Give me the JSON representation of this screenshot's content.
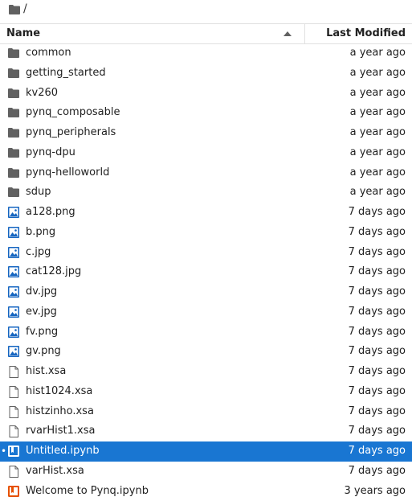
{
  "breadcrumb": {
    "separator": "/"
  },
  "header": {
    "name_label": "Name",
    "modified_label": "Last Modified"
  },
  "colors": {
    "selection": "#1976d2",
    "folder": "#616161",
    "image": "#1565c0",
    "notebook": "#1976d2",
    "pynq_notebook": "#e65100",
    "file": "#616161"
  },
  "files": [
    {
      "name": "common",
      "modified": "a year ago",
      "kind": "folder-icon"
    },
    {
      "name": "getting_started",
      "modified": "a year ago",
      "kind": "folder-icon"
    },
    {
      "name": "kv260",
      "modified": "a year ago",
      "kind": "folder-icon"
    },
    {
      "name": "pynq_composable",
      "modified": "a year ago",
      "kind": "folder-icon"
    },
    {
      "name": "pynq_peripherals",
      "modified": "a year ago",
      "kind": "folder-icon"
    },
    {
      "name": "pynq-dpu",
      "modified": "a year ago",
      "kind": "folder-icon"
    },
    {
      "name": "pynq-helloworld",
      "modified": "a year ago",
      "kind": "folder-icon"
    },
    {
      "name": "sdup",
      "modified": "a year ago",
      "kind": "folder-icon"
    },
    {
      "name": "a128.png",
      "modified": "7 days ago",
      "kind": "image-icon"
    },
    {
      "name": "b.png",
      "modified": "7 days ago",
      "kind": "image-icon"
    },
    {
      "name": "c.jpg",
      "modified": "7 days ago",
      "kind": "image-icon"
    },
    {
      "name": "cat128.jpg",
      "modified": "7 days ago",
      "kind": "image-icon"
    },
    {
      "name": "dv.jpg",
      "modified": "7 days ago",
      "kind": "image-icon"
    },
    {
      "name": "ev.jpg",
      "modified": "7 days ago",
      "kind": "image-icon"
    },
    {
      "name": "fv.png",
      "modified": "7 days ago",
      "kind": "image-icon"
    },
    {
      "name": "gv.png",
      "modified": "7 days ago",
      "kind": "image-icon"
    },
    {
      "name": "hist.xsa",
      "modified": "7 days ago",
      "kind": "file-icon"
    },
    {
      "name": "hist1024.xsa",
      "modified": "7 days ago",
      "kind": "file-icon"
    },
    {
      "name": "histzinho.xsa",
      "modified": "7 days ago",
      "kind": "file-icon"
    },
    {
      "name": "rvarHist1.xsa",
      "modified": "7 days ago",
      "kind": "file-icon"
    },
    {
      "name": "Untitled.ipynb",
      "modified": "7 days ago",
      "kind": "notebook-icon",
      "selected": true,
      "running": true
    },
    {
      "name": "varHist.xsa",
      "modified": "7 days ago",
      "kind": "file-icon"
    },
    {
      "name": "Welcome to Pynq.ipynb",
      "modified": "3 years ago",
      "kind": "pynq-notebook-icon"
    }
  ]
}
